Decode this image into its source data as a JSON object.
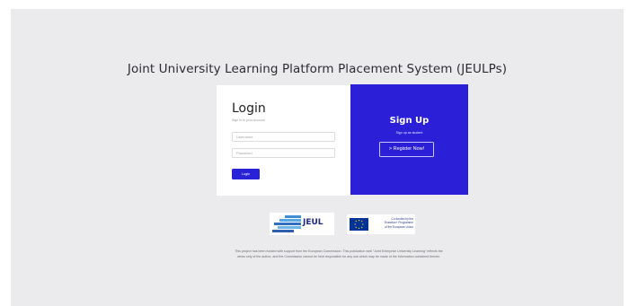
{
  "page": {
    "title": "Joint University Learning Platform Placement System (JEULPs)"
  },
  "login": {
    "heading": "Login",
    "subtitle": "Sign in to your Account",
    "username_placeholder": "Username",
    "password_placeholder": "Password",
    "button_label": "Login"
  },
  "signup": {
    "heading": "Sign Up",
    "subtitle": "Sign up as student",
    "register_label": "> Register Now!"
  },
  "logos": {
    "jeul_text": "JEUL",
    "eu_lines": [
      "Co-funded by the",
      "Erasmus+ Programme",
      "of the European Union"
    ]
  },
  "footer": {
    "disclaimer_line1": "This project has been funded with support from the European Commission. This publication web \"Joint Enterprise University Learning\" reflects the",
    "disclaimer_line2": "views only of the author, and the Commission cannot be held responsible for any use which may be made of the information contained therein."
  },
  "colors": {
    "accent": "#2b1fd8",
    "background": "#ebebed",
    "logo_navy": "#1f2a8a"
  },
  "icons": {
    "jeul_mark": "stacked-blue-bars-logo",
    "eu_flag": "eu-flag-stars"
  }
}
